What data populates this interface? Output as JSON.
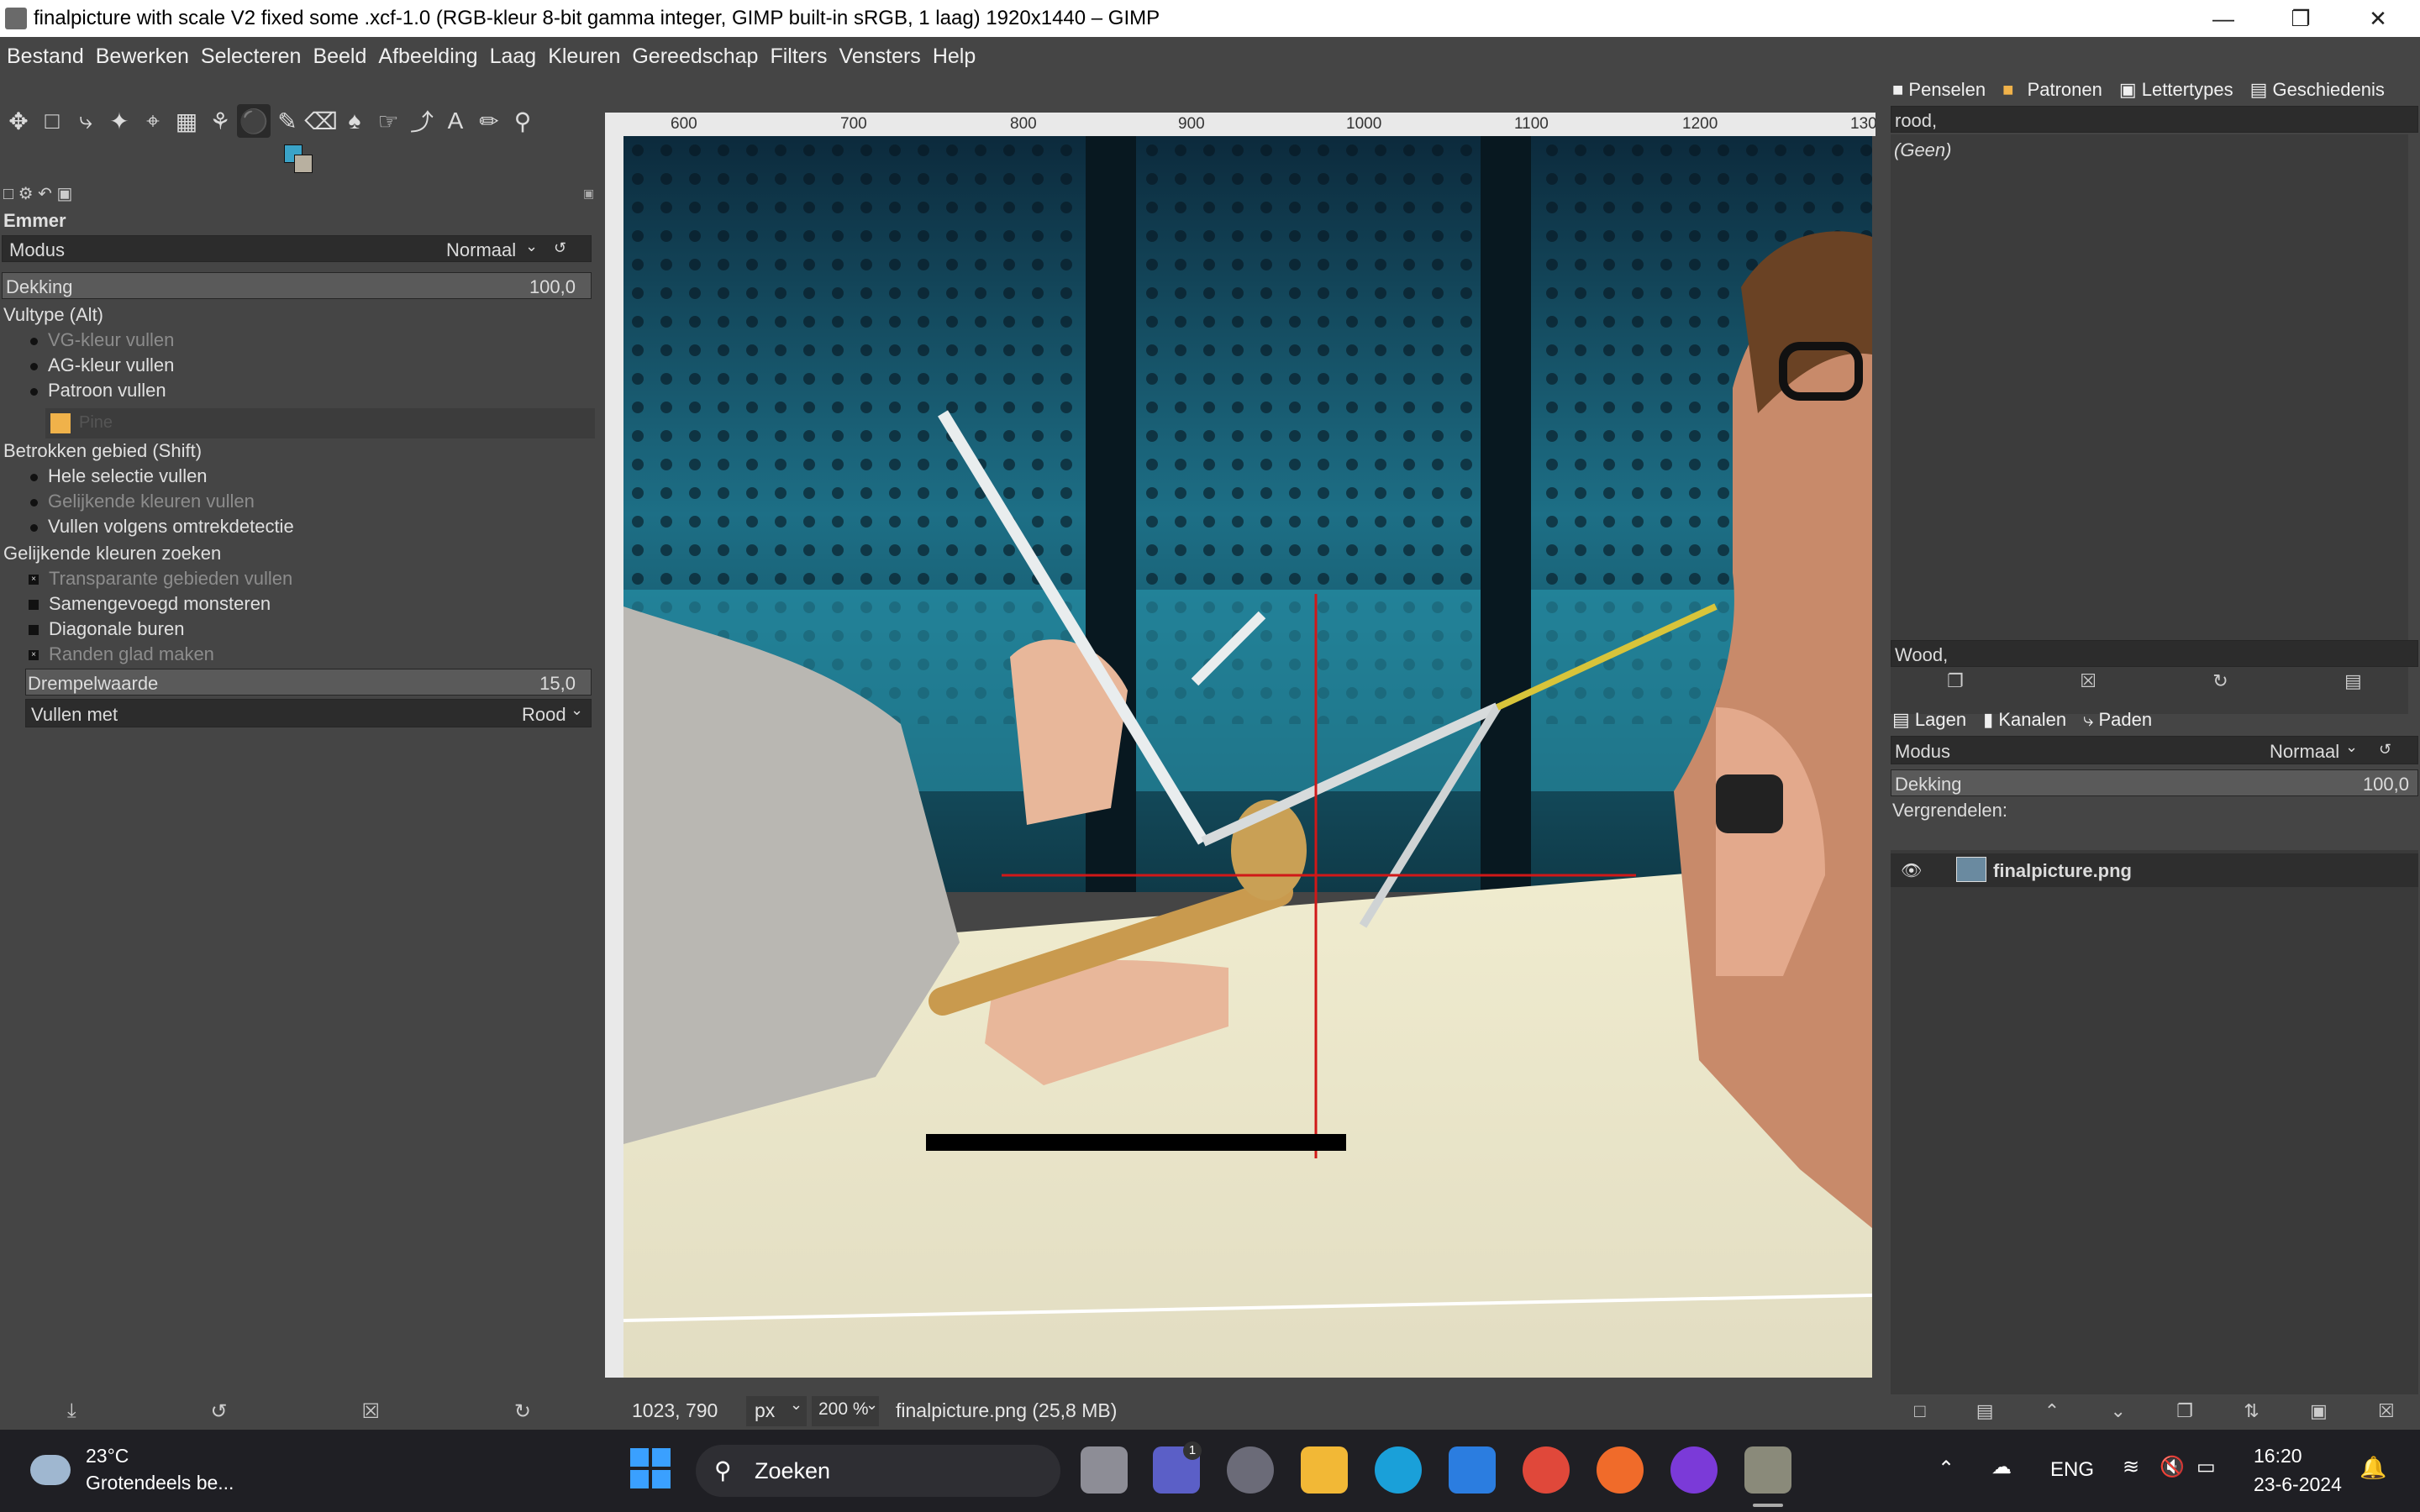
{
  "window": {
    "title": "finalpicture with scale V2 fixed some .xcf-1.0 (RGB-kleur 8-bit gamma integer, GIMP built-in sRGB, 1 laag) 1920x1440 – GIMP",
    "minimize_icon": "minimize-icon",
    "maximize_icon": "restore-icon",
    "close_icon": "close-icon"
  },
  "menubar": [
    "Bestand",
    "Bewerken",
    "Selecteren",
    "Beeld",
    "Afbeelding",
    "Laag",
    "Kleuren",
    "Gereedschap",
    "Filters",
    "Vensters",
    "Help"
  ],
  "tool_options": {
    "title": "Emmer",
    "mode_label": "Modus",
    "mode_value": "Normaal",
    "opacity_label": "Dekking",
    "opacity_value": "100,0",
    "fill_type_label": "Vultype (Alt)",
    "fill_types": [
      "VG-kleur vullen",
      "AG-kleur vullen",
      "Patroon vullen"
    ],
    "pattern_name": "Pine",
    "affected_label": "Betrokken gebied (Shift)",
    "affected": [
      "Hele selectie vullen",
      "Gelijkende kleuren vullen",
      "Vullen volgens omtrekdetectie"
    ],
    "similar_label": "Gelijkende kleuren zoeken",
    "similar_opts": [
      "Transparante gebieden vullen",
      "Samengevoegd monsteren",
      "Diagonale buren",
      "Randen glad maken"
    ],
    "threshold_label": "Drempelwaarde",
    "threshold_value": "15,0",
    "fill_with_label": "Vullen met",
    "fill_with_value": "Rood"
  },
  "ruler": {
    "ticks": [
      "600",
      "700",
      "800",
      "900",
      "1000",
      "1100",
      "1200",
      "130"
    ]
  },
  "status": {
    "coords": "1023, 790",
    "unit": "px",
    "zoom": "200 %",
    "file": "finalpicture.png (25,8 MB)"
  },
  "right_dock": {
    "tabs": [
      "Penselen",
      "Patronen",
      "Lettertypes",
      "Geschiedenis"
    ],
    "brush_filter": "rood,",
    "brush_none": "(Geen)",
    "pattern_filter": "Wood,",
    "layer_tabs": [
      "Lagen",
      "Kanalen",
      "Paden"
    ],
    "mode_label": "Modus",
    "mode_value": "Normaal",
    "opacity_label": "Dekking",
    "opacity_value": "100,0",
    "lock_label": "Vergrendelen:",
    "layer_name": "finalpicture.png"
  },
  "taskbar": {
    "weather_temp": "23°C",
    "weather_desc": "Grotendeels be...",
    "search_placeholder": "Zoeken",
    "teams_badge": "1",
    "language": "ENG",
    "time": "16:20",
    "date": "23-6-2024"
  },
  "colors": {
    "fg_color": "#3aa3c8",
    "bg_color": "#b8b0a0",
    "pattern_swatch": "#f0b24a",
    "crosshair": "#d01818"
  }
}
